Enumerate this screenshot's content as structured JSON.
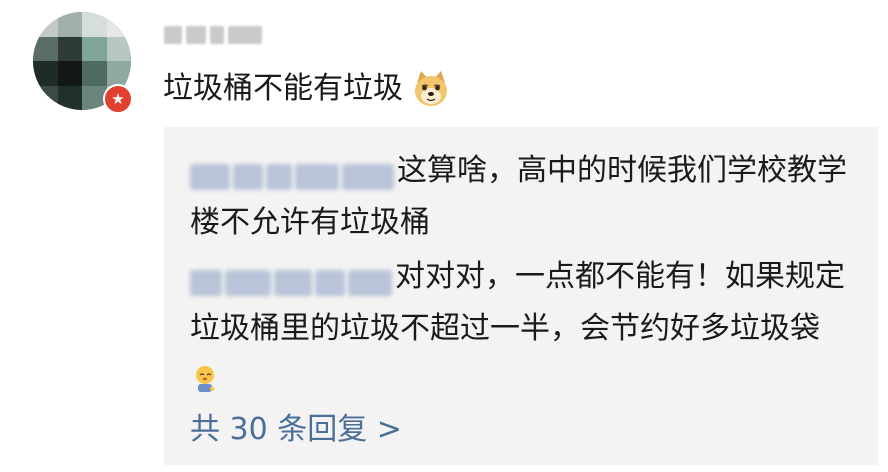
{
  "post": {
    "text": "垃圾桶不能有垃圾",
    "emoji_icon": "doge-emoji-icon",
    "badge_icon": "verified-badge-icon"
  },
  "replies": [
    {
      "text": "这算啥，高中的时候我们学校教学楼不允许有垃圾桶"
    },
    {
      "text": "对对对，一点都不能有！如果规定垃圾桶里的垃圾不超过一半，会节约好多垃圾袋",
      "emoji_icon": "shy-face-emoji-icon"
    }
  ],
  "more_replies_label": "共 30 条回复 >",
  "colors": {
    "link": "#4b6f98",
    "reply_bg": "#f3f3f3",
    "badge": "#e2402f"
  }
}
